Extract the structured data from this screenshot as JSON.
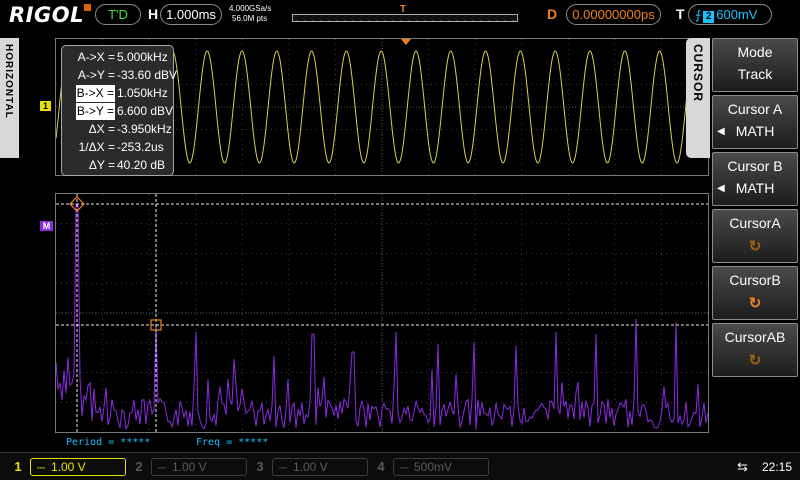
{
  "top_bar": {
    "brand": "RIGOL",
    "run_state": "T'D",
    "horizontal_label": "H",
    "timebase": "1.000ms",
    "sample_rate": "4.000GSa/s",
    "memory_depth": "56.0M pts",
    "delay_label": "D",
    "delay": "0.00000000ps",
    "trigger_label": "T",
    "trigger_edge_icon": "rising-edge-icon",
    "trigger_source": "2",
    "trigger_level": "600mV",
    "colors": {
      "run_state": "#3ee23e",
      "delay": "#f08020",
      "trigger": "#19c2ff"
    }
  },
  "left_tab": {
    "label": "HORIZONTAL"
  },
  "markers": {
    "channel1": "1",
    "math": "M"
  },
  "cursor_readout": {
    "rows": [
      {
        "label": "A->X =",
        "value": "5.000kHz",
        "boxed": false
      },
      {
        "label": "A->Y =",
        "value": "-33.60 dBV",
        "boxed": false
      },
      {
        "label": "B->X =",
        "value": "1.050kHz",
        "boxed": true
      },
      {
        "label": "B->Y =",
        "value": "6.600 dBV",
        "boxed": true
      },
      {
        "label": "ΔX =",
        "value": "-3.950kHz",
        "boxed": false
      },
      {
        "label": "1/ΔX =",
        "value": "-253.2us",
        "boxed": false
      },
      {
        "label": "ΔY =",
        "value": "40.20 dB",
        "boxed": false
      }
    ]
  },
  "measurements": {
    "period": "Period = *****",
    "freq": "Freq = *****"
  },
  "side_menu": {
    "tab_label": "CURSOR",
    "items": [
      {
        "title": "Mode",
        "value": "Track"
      },
      {
        "title": "Cursor A",
        "value": "MATH"
      },
      {
        "title": "Cursor B",
        "value": "MATH"
      },
      {
        "title": "CursorA",
        "knob": "↻"
      },
      {
        "title": "CursorB",
        "knob": "↻"
      },
      {
        "title": "CursorAB",
        "knob": "↻"
      }
    ]
  },
  "status_bar": {
    "channels": [
      {
        "num": "1",
        "scale": "1.00 V",
        "enabled": true
      },
      {
        "num": "2",
        "scale": "1.00 V",
        "enabled": false
      },
      {
        "num": "3",
        "scale": "1.00 V",
        "enabled": false
      },
      {
        "num": "4",
        "scale": "500mV",
        "enabled": false
      }
    ],
    "coupling_icon": "dc-coupling-icon",
    "usb_icon": "usb-icon",
    "clock": "22:15"
  }
}
